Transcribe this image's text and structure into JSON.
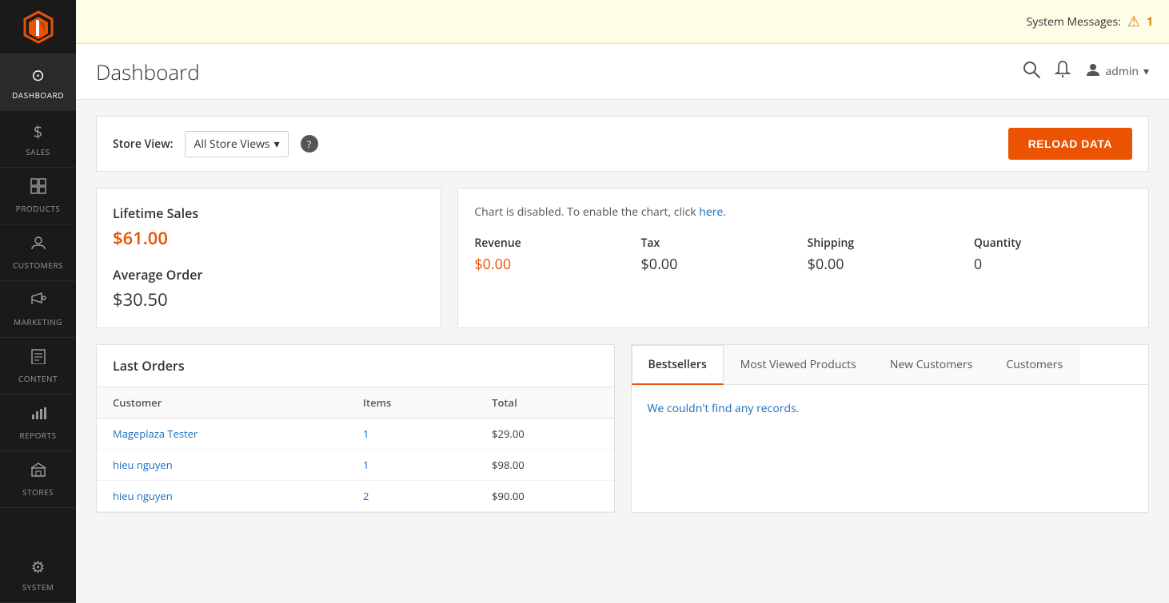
{
  "system_messages": {
    "label": "System Messages:",
    "count": "1"
  },
  "header": {
    "title": "Dashboard",
    "search_title": "Search",
    "notifications_title": "Notifications",
    "user_label": "admin",
    "chevron": "▾"
  },
  "sidebar": {
    "logo_alt": "Magento Logo",
    "items": [
      {
        "id": "dashboard",
        "label": "DASHBOARD",
        "icon": "⊙",
        "active": true
      },
      {
        "id": "sales",
        "label": "SALES",
        "icon": "$"
      },
      {
        "id": "products",
        "label": "PRODUCTS",
        "icon": "⬜"
      },
      {
        "id": "customers",
        "label": "CUSTOMERS",
        "icon": "👤"
      },
      {
        "id": "marketing",
        "label": "MARKETING",
        "icon": "📢"
      },
      {
        "id": "content",
        "label": "CONTENT",
        "icon": "📄"
      },
      {
        "id": "reports",
        "label": "REPORTS",
        "icon": "📊"
      },
      {
        "id": "stores",
        "label": "STORES",
        "icon": "🏪"
      },
      {
        "id": "system",
        "label": "SYSTEM",
        "icon": "⚙"
      }
    ]
  },
  "store_view_bar": {
    "label": "Store View:",
    "selected": "All Store Views",
    "chevron": "▾",
    "help_text": "?",
    "reload_button": "Reload Data"
  },
  "lifetime_sales": {
    "label": "Lifetime Sales",
    "value": "$61.00"
  },
  "average_order": {
    "label": "Average Order",
    "value": "$30.50"
  },
  "chart": {
    "disabled_prefix": "Chart is disabled. To enable the chart, click ",
    "disabled_link": "here",
    "disabled_suffix": "."
  },
  "metrics": [
    {
      "label": "Revenue",
      "value": "$0.00",
      "orange": true
    },
    {
      "label": "Tax",
      "value": "$0.00",
      "orange": false
    },
    {
      "label": "Shipping",
      "value": "$0.00",
      "orange": false
    },
    {
      "label": "Quantity",
      "value": "0",
      "orange": false
    }
  ],
  "last_orders": {
    "title": "Last Orders",
    "columns": [
      "Customer",
      "Items",
      "Total"
    ],
    "rows": [
      {
        "customer": "Mageplaza Tester",
        "items": "1",
        "total": "$29.00"
      },
      {
        "customer": "hieu nguyen",
        "items": "1",
        "total": "$98.00"
      },
      {
        "customer": "hieu nguyen",
        "items": "2",
        "total": "$90.00"
      }
    ]
  },
  "tabs": {
    "items": [
      {
        "id": "bestsellers",
        "label": "Bestsellers",
        "active": true
      },
      {
        "id": "most-viewed",
        "label": "Most Viewed Products",
        "active": false
      },
      {
        "id": "new-customers",
        "label": "New Customers",
        "active": false
      },
      {
        "id": "customers",
        "label": "Customers",
        "active": false
      }
    ],
    "empty_message": "We couldn't find any records."
  },
  "colors": {
    "orange": "#eb5202",
    "sidebar_bg": "#1a1a1a",
    "link_blue": "#1a6cbe"
  }
}
